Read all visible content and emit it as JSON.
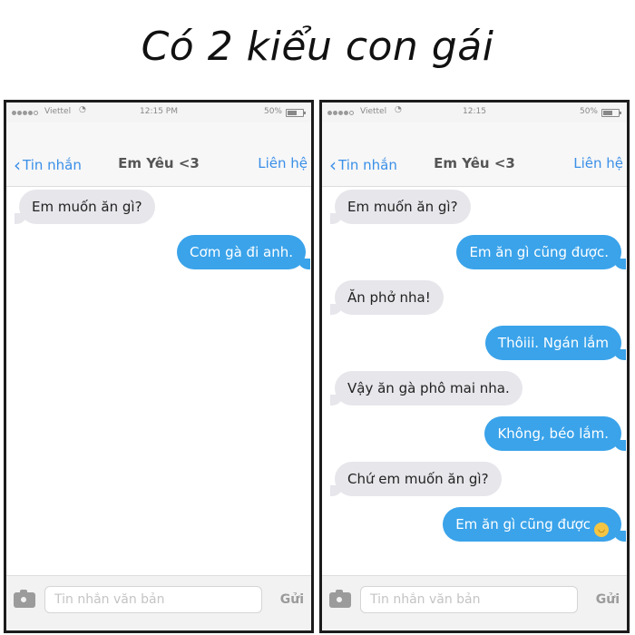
{
  "title": "Có 2 kiểu con gái",
  "colors": {
    "bubble_out": "#3aa3ea",
    "bubble_in": "#e6e6eb",
    "accent": "#3a8fe8"
  },
  "phones": [
    {
      "status": {
        "carrier": "Viettel",
        "time": "12:15 PM",
        "battery": "50%"
      },
      "nav": {
        "back_label": "Tin nhắn",
        "title": "Em Yêu <3",
        "contact_label": "Liên hệ"
      },
      "messages": [
        {
          "from": "in",
          "text": "Em muốn ăn gì?"
        },
        {
          "from": "out",
          "text": "Cơm gà đi anh."
        }
      ],
      "input": {
        "placeholder": "Tin nhắn văn bản",
        "send_label": "Gửi",
        "camera_icon": "camera-icon"
      }
    },
    {
      "status": {
        "carrier": "Viettel",
        "time": "12:15",
        "battery": "50%"
      },
      "nav": {
        "back_label": "Tin nhắn",
        "title": "Em Yêu <3",
        "contact_label": "Liên hệ"
      },
      "messages": [
        {
          "from": "in",
          "text": "Em muốn ăn gì?"
        },
        {
          "from": "out",
          "text": "Em ăn gì cũng được."
        },
        {
          "from": "in",
          "text": "Ăn phở nha!"
        },
        {
          "from": "out",
          "text": "Thôiii. Ngán lắm"
        },
        {
          "from": "in",
          "text": "Vậy ăn gà phô mai nha."
        },
        {
          "from": "out",
          "text": "Không, béo lắm."
        },
        {
          "from": "in",
          "text": "Chứ em muốn ăn gì?"
        },
        {
          "from": "out",
          "text": "Em ăn gì cũng được",
          "emoji": "smiling-face-icon"
        }
      ],
      "input": {
        "placeholder": "Tin nhắn văn bản",
        "send_label": "Gửi",
        "camera_icon": "camera-icon"
      }
    }
  ]
}
